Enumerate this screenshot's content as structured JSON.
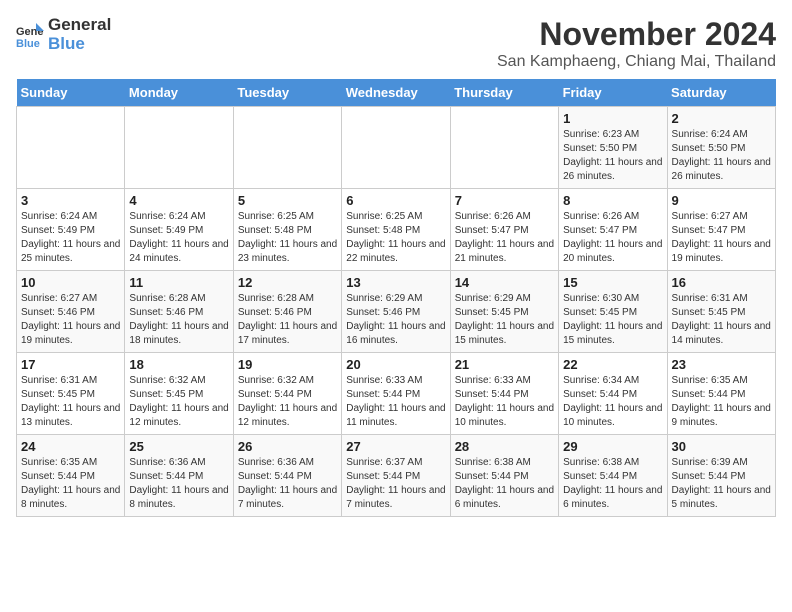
{
  "logo": {
    "general": "General",
    "blue": "Blue"
  },
  "title": "November 2024",
  "subtitle": "San Kamphaeng, Chiang Mai, Thailand",
  "days_of_week": [
    "Sunday",
    "Monday",
    "Tuesday",
    "Wednesday",
    "Thursday",
    "Friday",
    "Saturday"
  ],
  "weeks": [
    [
      {
        "day": "",
        "info": ""
      },
      {
        "day": "",
        "info": ""
      },
      {
        "day": "",
        "info": ""
      },
      {
        "day": "",
        "info": ""
      },
      {
        "day": "",
        "info": ""
      },
      {
        "day": "1",
        "info": "Sunrise: 6:23 AM\nSunset: 5:50 PM\nDaylight: 11 hours and 26 minutes."
      },
      {
        "day": "2",
        "info": "Sunrise: 6:24 AM\nSunset: 5:50 PM\nDaylight: 11 hours and 26 minutes."
      }
    ],
    [
      {
        "day": "3",
        "info": "Sunrise: 6:24 AM\nSunset: 5:49 PM\nDaylight: 11 hours and 25 minutes."
      },
      {
        "day": "4",
        "info": "Sunrise: 6:24 AM\nSunset: 5:49 PM\nDaylight: 11 hours and 24 minutes."
      },
      {
        "day": "5",
        "info": "Sunrise: 6:25 AM\nSunset: 5:48 PM\nDaylight: 11 hours and 23 minutes."
      },
      {
        "day": "6",
        "info": "Sunrise: 6:25 AM\nSunset: 5:48 PM\nDaylight: 11 hours and 22 minutes."
      },
      {
        "day": "7",
        "info": "Sunrise: 6:26 AM\nSunset: 5:47 PM\nDaylight: 11 hours and 21 minutes."
      },
      {
        "day": "8",
        "info": "Sunrise: 6:26 AM\nSunset: 5:47 PM\nDaylight: 11 hours and 20 minutes."
      },
      {
        "day": "9",
        "info": "Sunrise: 6:27 AM\nSunset: 5:47 PM\nDaylight: 11 hours and 19 minutes."
      }
    ],
    [
      {
        "day": "10",
        "info": "Sunrise: 6:27 AM\nSunset: 5:46 PM\nDaylight: 11 hours and 19 minutes."
      },
      {
        "day": "11",
        "info": "Sunrise: 6:28 AM\nSunset: 5:46 PM\nDaylight: 11 hours and 18 minutes."
      },
      {
        "day": "12",
        "info": "Sunrise: 6:28 AM\nSunset: 5:46 PM\nDaylight: 11 hours and 17 minutes."
      },
      {
        "day": "13",
        "info": "Sunrise: 6:29 AM\nSunset: 5:46 PM\nDaylight: 11 hours and 16 minutes."
      },
      {
        "day": "14",
        "info": "Sunrise: 6:29 AM\nSunset: 5:45 PM\nDaylight: 11 hours and 15 minutes."
      },
      {
        "day": "15",
        "info": "Sunrise: 6:30 AM\nSunset: 5:45 PM\nDaylight: 11 hours and 15 minutes."
      },
      {
        "day": "16",
        "info": "Sunrise: 6:31 AM\nSunset: 5:45 PM\nDaylight: 11 hours and 14 minutes."
      }
    ],
    [
      {
        "day": "17",
        "info": "Sunrise: 6:31 AM\nSunset: 5:45 PM\nDaylight: 11 hours and 13 minutes."
      },
      {
        "day": "18",
        "info": "Sunrise: 6:32 AM\nSunset: 5:45 PM\nDaylight: 11 hours and 12 minutes."
      },
      {
        "day": "19",
        "info": "Sunrise: 6:32 AM\nSunset: 5:44 PM\nDaylight: 11 hours and 12 minutes."
      },
      {
        "day": "20",
        "info": "Sunrise: 6:33 AM\nSunset: 5:44 PM\nDaylight: 11 hours and 11 minutes."
      },
      {
        "day": "21",
        "info": "Sunrise: 6:33 AM\nSunset: 5:44 PM\nDaylight: 11 hours and 10 minutes."
      },
      {
        "day": "22",
        "info": "Sunrise: 6:34 AM\nSunset: 5:44 PM\nDaylight: 11 hours and 10 minutes."
      },
      {
        "day": "23",
        "info": "Sunrise: 6:35 AM\nSunset: 5:44 PM\nDaylight: 11 hours and 9 minutes."
      }
    ],
    [
      {
        "day": "24",
        "info": "Sunrise: 6:35 AM\nSunset: 5:44 PM\nDaylight: 11 hours and 8 minutes."
      },
      {
        "day": "25",
        "info": "Sunrise: 6:36 AM\nSunset: 5:44 PM\nDaylight: 11 hours and 8 minutes."
      },
      {
        "day": "26",
        "info": "Sunrise: 6:36 AM\nSunset: 5:44 PM\nDaylight: 11 hours and 7 minutes."
      },
      {
        "day": "27",
        "info": "Sunrise: 6:37 AM\nSunset: 5:44 PM\nDaylight: 11 hours and 7 minutes."
      },
      {
        "day": "28",
        "info": "Sunrise: 6:38 AM\nSunset: 5:44 PM\nDaylight: 11 hours and 6 minutes."
      },
      {
        "day": "29",
        "info": "Sunrise: 6:38 AM\nSunset: 5:44 PM\nDaylight: 11 hours and 6 minutes."
      },
      {
        "day": "30",
        "info": "Sunrise: 6:39 AM\nSunset: 5:44 PM\nDaylight: 11 hours and 5 minutes."
      }
    ]
  ]
}
